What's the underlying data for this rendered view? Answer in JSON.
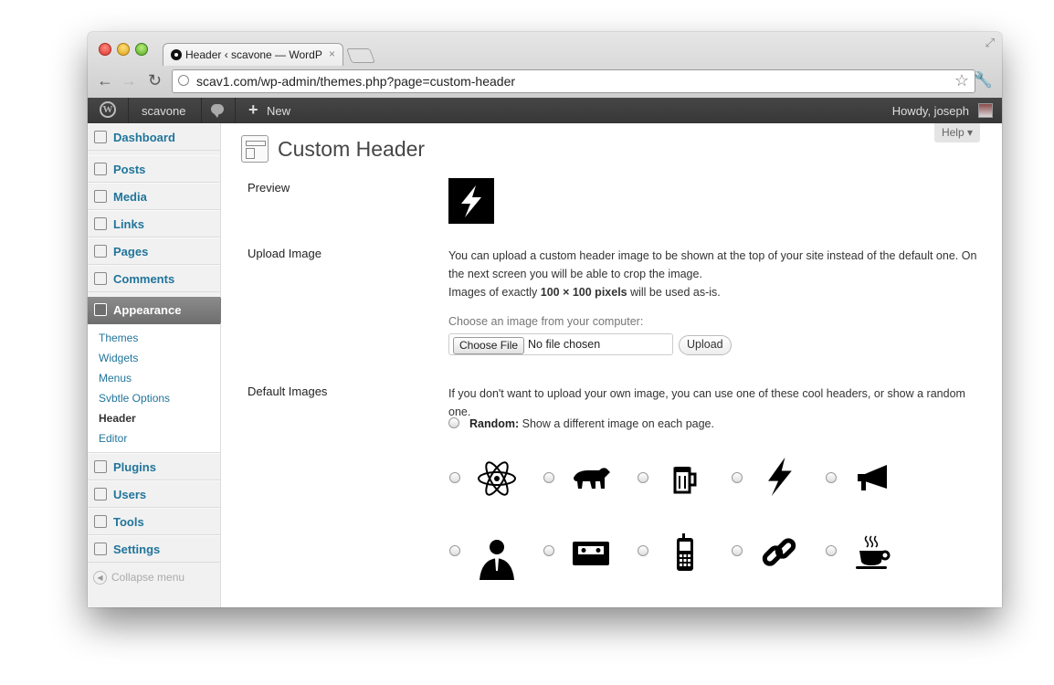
{
  "browser": {
    "tab_title": "Header ‹ scavone — WordPre",
    "tab_close": "×",
    "url": "scav1.com/wp-admin/themes.php?page=custom-header"
  },
  "admin_bar": {
    "site_name": "scavone",
    "new_label": "New",
    "howdy": "Howdy, joseph"
  },
  "sidebar": {
    "items": [
      {
        "label": "Dashboard",
        "icon": "dashboard-icon"
      },
      {
        "label": "Posts",
        "icon": "pin-icon"
      },
      {
        "label": "Media",
        "icon": "media-icon"
      },
      {
        "label": "Links",
        "icon": "link-icon"
      },
      {
        "label": "Pages",
        "icon": "pages-icon"
      },
      {
        "label": "Comments",
        "icon": "comment-icon"
      },
      {
        "label": "Appearance",
        "icon": "appearance-icon"
      },
      {
        "label": "Plugins",
        "icon": "plug-icon"
      },
      {
        "label": "Users",
        "icon": "users-icon"
      },
      {
        "label": "Tools",
        "icon": "tools-icon"
      },
      {
        "label": "Settings",
        "icon": "settings-icon"
      }
    ],
    "submenu": [
      "Themes",
      "Widgets",
      "Menus",
      "Svbtle Options",
      "Header",
      "Editor"
    ],
    "collapse": "Collapse menu"
  },
  "main": {
    "title": "Custom Header",
    "help": "Help ▾",
    "preview_label": "Preview",
    "upload_label": "Upload Image",
    "upload_text_1": "You can upload a custom header image to be shown at the top of your site instead of the default one. On the next screen you will be able to crop the image.",
    "upload_text_2_pre": "Images of exactly ",
    "upload_text_2_bold": "100 × 100 pixels",
    "upload_text_2_post": " will be used as-is.",
    "choose_label": "Choose an image from your computer:",
    "choose_button": "Choose File",
    "file_status": "No file chosen",
    "upload_button": "Upload",
    "default_label": "Default Images",
    "default_text": "If you don't want to upload your own image, you can use one of these cool headers, or show a random one.",
    "random_bold": "Random:",
    "random_text": " Show a different image on each page.",
    "images": [
      "atom-icon",
      "bear-icon",
      "beer-mug-icon",
      "lightning-icon",
      "megaphone-icon",
      "businessman-icon",
      "cassette-icon",
      "mobile-phone-icon",
      "chain-link-icon",
      "coffee-cup-icon"
    ]
  },
  "colors": {
    "link": "#21759b",
    "admin_bar": "#464646",
    "active_menu": "#7c7c7c"
  }
}
